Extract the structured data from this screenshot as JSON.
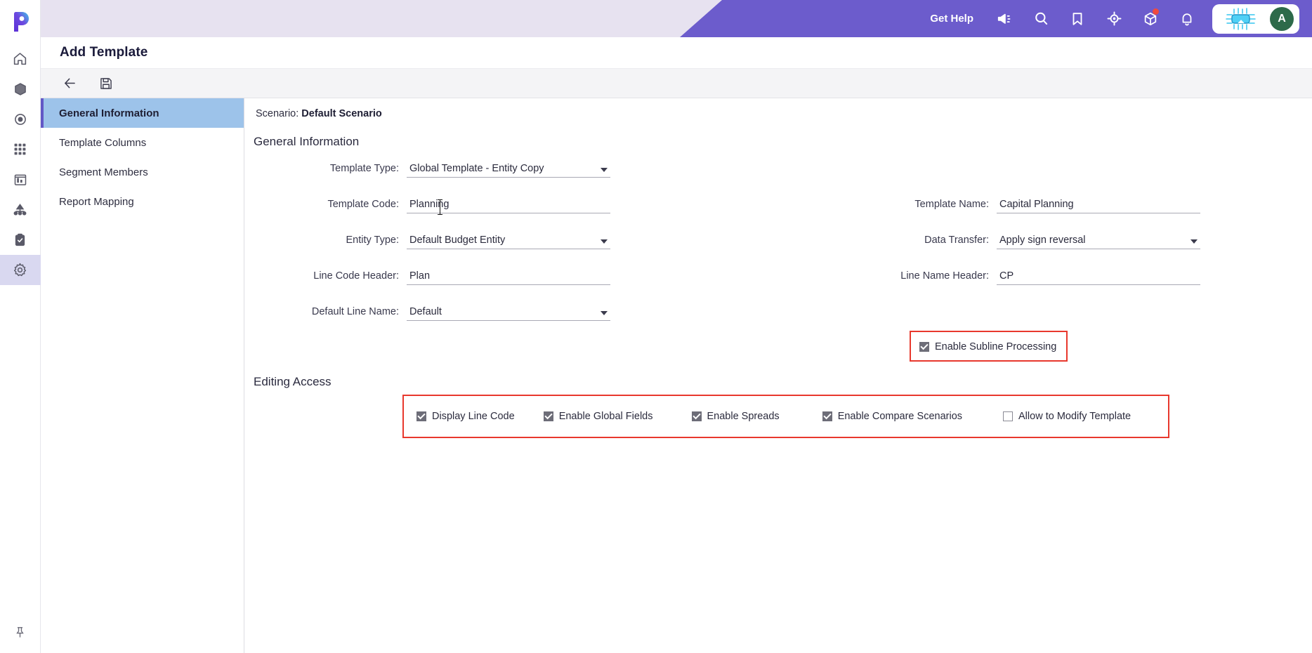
{
  "app": {
    "logo_icon": "planful-p-logo"
  },
  "topbar": {
    "get_help": "Get Help",
    "icons": [
      {
        "name": "announcement-icon",
        "label": "Announcements"
      },
      {
        "name": "search-icon",
        "label": "Search"
      },
      {
        "name": "bookmark-icon",
        "label": "Bookmarks"
      },
      {
        "name": "target-icon",
        "label": "Quick Navigation"
      },
      {
        "name": "package-icon",
        "label": "What's New"
      },
      {
        "name": "bell-icon",
        "label": "Notifications"
      }
    ],
    "ai_icon": "ai-chip-icon",
    "avatar_initial": "A",
    "purple": "#6c5ccc",
    "band": "#e7e2f0"
  },
  "rail": {
    "items": [
      {
        "name": "home-icon",
        "label": "Home",
        "active": false
      },
      {
        "name": "cube-icon",
        "label": "Structured Planning",
        "active": false
      },
      {
        "name": "target-dot-icon",
        "label": "Dynamic Planning",
        "active": false
      },
      {
        "name": "grid-icon",
        "label": "Consolidation",
        "active": false
      },
      {
        "name": "chart-icon",
        "label": "Reports",
        "active": false
      },
      {
        "name": "hierarchy-icon",
        "label": "Workforce",
        "active": false
      },
      {
        "name": "clipboard-check-icon",
        "label": "Tasks",
        "active": false
      },
      {
        "name": "gear-icon",
        "label": "Maintenance",
        "active": true
      }
    ],
    "pin_icon": "pin-icon"
  },
  "page": {
    "title": "Add Template"
  },
  "toolbar": {
    "back_label": "Back",
    "save_label": "Save",
    "back_icon": "arrow-left-icon",
    "save_icon": "floppy-save-icon"
  },
  "nav": {
    "items": [
      {
        "label": "General Information",
        "active": true
      },
      {
        "label": "Template Columns",
        "active": false
      },
      {
        "label": "Segment Members",
        "active": false
      },
      {
        "label": "Report Mapping",
        "active": false
      }
    ]
  },
  "main": {
    "scenario_label": "Scenario:",
    "scenario_value": "Default Scenario",
    "general_information_title": "General Information",
    "editing_access_title": "Editing Access",
    "fields": {
      "template_type": {
        "label": "Template Type:",
        "value": "Global Template - Entity Copy",
        "type": "select"
      },
      "template_name": {
        "label": "Template Name:",
        "value": "Capital Planning",
        "type": "text"
      },
      "template_code": {
        "label": "Template Code:",
        "value": "Planning",
        "type": "text"
      },
      "data_transfer": {
        "label": "Data Transfer:",
        "value": "Apply sign reversal",
        "type": "select"
      },
      "entity_type": {
        "label": "Entity Type:",
        "value": "Default Budget Entity",
        "type": "select"
      },
      "line_code_header": {
        "label": "Line Code Header:",
        "value": "Plan",
        "type": "text"
      },
      "line_name_header": {
        "label": "Line Name Header:",
        "value": "CP",
        "type": "text"
      },
      "default_line_name": {
        "label": "Default Line Name:",
        "value": "Default",
        "type": "select"
      }
    },
    "subline": {
      "label": "Enable Subline Processing",
      "checked": true,
      "highlight_color": "#e8382d"
    },
    "editing_access_options": [
      {
        "label": "Display Line Code",
        "checked": true
      },
      {
        "label": "Enable Global Fields",
        "checked": true
      },
      {
        "label": "Enable Spreads",
        "checked": true
      },
      {
        "label": "Enable Compare Scenarios",
        "checked": true
      },
      {
        "label": "Allow to Modify Template",
        "checked": false
      }
    ],
    "editing_access_highlight_color": "#e8382d"
  }
}
